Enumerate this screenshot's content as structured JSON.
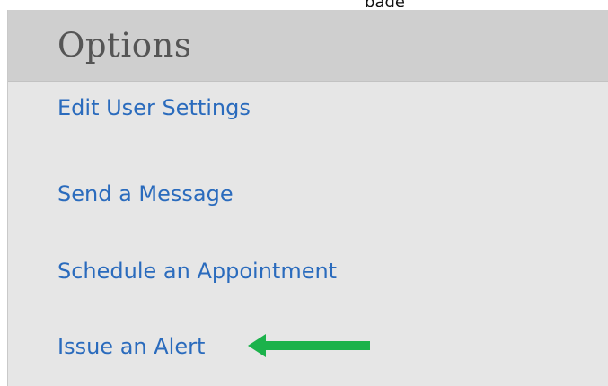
{
  "top_text": "page",
  "options_panel": {
    "title": "Options",
    "items": [
      {
        "label": "Edit User Settings"
      },
      {
        "label": "Send a Message"
      },
      {
        "label": "Schedule an Appointment"
      },
      {
        "label": "Issue an Alert"
      }
    ]
  },
  "annotation": {
    "icon": "left-arrow-icon",
    "color": "#1bb24b"
  },
  "colors": {
    "link": "#2a6bbd",
    "header_bg": "#cfcfcf",
    "panel_bg": "#e6e6e6",
    "title": "#555555"
  }
}
